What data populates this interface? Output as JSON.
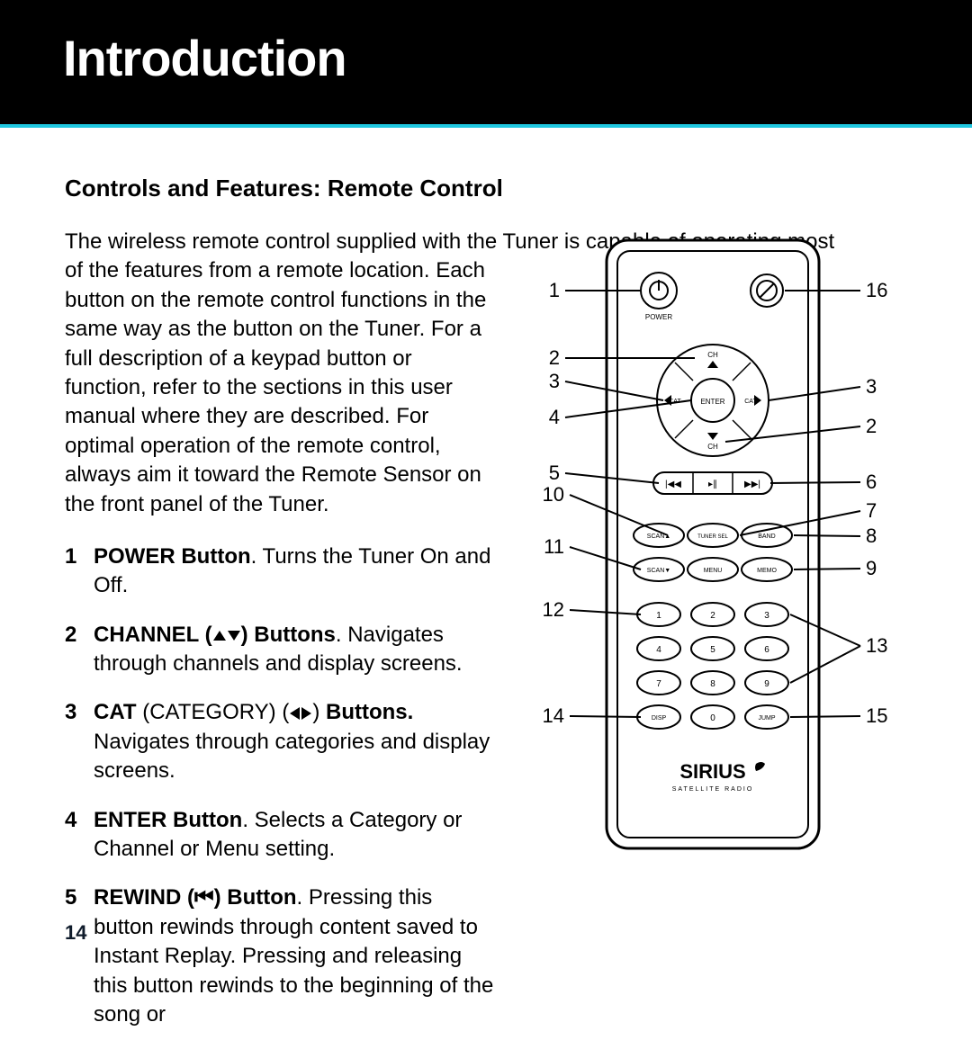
{
  "header": {
    "title": "Introduction"
  },
  "subheading": "Controls and Features: Remote Control",
  "intro_line": "The wireless remote control supplied with the Tuner is capable of operating most",
  "intro_wrap": "of the features from a remote location. Each button on the remote control functions in the same way as the button on the Tuner. For a full description of a keypad button or function, refer to the sections in this user manual where they are described. For optimal operation of the remote control, always aim it toward the Remote Sensor on the front panel of the Tuner.",
  "list": [
    {
      "n": "1",
      "lead": "POWER Button",
      "rest": ". Turns the Tuner On and Off."
    },
    {
      "n": "2",
      "lead": "CHANNEL (",
      "rest": " Buttons",
      "rest2": ". Navigates through channels and display screens.",
      "icons": "updown"
    },
    {
      "n": "3",
      "lead": "CAT",
      "rest_lead2": " (CATEGORY) (",
      "rest": " Buttons.",
      "rest2": " Navigates through categories and display screens.",
      "icons": "leftright"
    },
    {
      "n": "4",
      "lead": "ENTER Button",
      "rest": ". Selects a Category or Channel or Menu setting."
    },
    {
      "n": "5",
      "lead": "REWIND (",
      "rest": " Button",
      "rest2": ". Pressing this button rewinds through content saved to Instant Replay. Pressing and releasing this button rewinds to the beginning of the song or",
      "icons": "rewind"
    }
  ],
  "page_number": "14",
  "callouts_left": [
    "1",
    "2",
    "3",
    "4",
    "5",
    "10",
    "11",
    "12",
    "14"
  ],
  "callouts_right": [
    "16",
    "3",
    "2",
    "6",
    "7",
    "8",
    "9",
    "13",
    "15"
  ],
  "remote": {
    "power_label": "POWER",
    "dpad": {
      "ch_up": "CH",
      "ch_down": "CH",
      "cat_l": "CAT",
      "cat_r": "CAT",
      "enter": "ENTER"
    },
    "transport": [
      "⏮",
      "▸∥",
      "⏭"
    ],
    "row1": [
      "SCAN▲",
      "TUNER SEL",
      "BAND"
    ],
    "row2": [
      "SCAN▼",
      "MENU",
      "MEMO"
    ],
    "keypad": [
      "1",
      "2",
      "3",
      "4",
      "5",
      "6",
      "7",
      "8",
      "9",
      "DISP",
      "0",
      "JUMP"
    ],
    "brand": "SIRIUS",
    "brand_sub": "S A T E L L I T E   R A D I O"
  }
}
